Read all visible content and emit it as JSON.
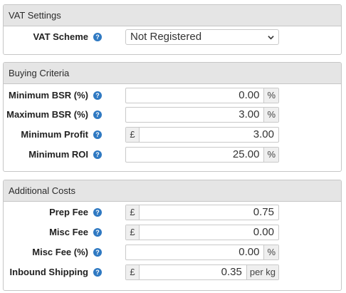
{
  "vat": {
    "title": "VAT Settings",
    "scheme_label": "VAT Scheme",
    "scheme_value": "Not Registered"
  },
  "buying": {
    "title": "Buying Criteria",
    "rows": [
      {
        "label": "Minimum BSR (%)",
        "value": "0.00",
        "suffix": "%"
      },
      {
        "label": "Maximum BSR (%)",
        "value": "3.00",
        "suffix": "%"
      },
      {
        "label": "Minimum Profit",
        "value": "3.00",
        "prefix": "£"
      },
      {
        "label": "Minimum ROI",
        "value": "25.00",
        "suffix": "%"
      }
    ]
  },
  "costs": {
    "title": "Additional Costs",
    "rows": [
      {
        "label": "Prep Fee",
        "value": "0.75",
        "prefix": "£"
      },
      {
        "label": "Misc Fee",
        "value": "0.00",
        "prefix": "£"
      },
      {
        "label": "Misc Fee (%)",
        "value": "0.00",
        "suffix": "%"
      },
      {
        "label": "Inbound Shipping",
        "value": "0.35",
        "prefix": "£",
        "suffix": "per kg"
      }
    ]
  },
  "help_glyph": "?",
  "colors": {
    "header_bg": "#e5e5e5",
    "help_icon": "#2f79c2",
    "addon_bg": "#efefef"
  }
}
